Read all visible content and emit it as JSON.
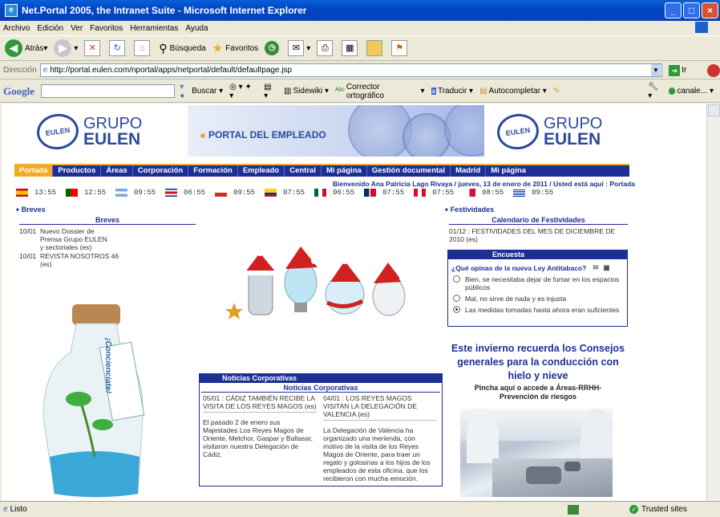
{
  "window": {
    "title": "Net.Portal 2005, the Intranet Suite - Microsoft Internet Explorer"
  },
  "menu": [
    "Archivo",
    "Edición",
    "Ver",
    "Favoritos",
    "Herramientas",
    "Ayuda"
  ],
  "toolbar": {
    "back": "Atrás",
    "search": "Búsqueda",
    "favorites": "Favoritos"
  },
  "address": {
    "label": "Dirección",
    "url": "http://portal.eulen.com/nportal/apps/netportal/default/defaultpage.jsp",
    "go": "Ir"
  },
  "google": {
    "logo": "Google",
    "buscar": "Buscar",
    "sidewiki": "Sidewiki",
    "corrector": "Corrector ortográfico",
    "traducir": "Traducir",
    "autocompletar": "Autocompletar",
    "profile": "canale..."
  },
  "logo": {
    "line1": "GRUPO",
    "line2": "EULEN"
  },
  "banner": {
    "title": "PORTAL DEL EMPLEADO"
  },
  "nav": [
    "Portada",
    "Productos",
    "Áreas",
    "Corporación",
    "Formación",
    "Empleado",
    "Central",
    "Mi página",
    "Gestión documental",
    "Madrid",
    "Mi página"
  ],
  "welcome": "Bienvenido Ana Patricia Lago Rivaya / jueves, 13 de enero de 2011 / Usted está aquí : Portada",
  "clocks": [
    {
      "time": "13:55",
      "flag": "es"
    },
    {
      "time": "12:55",
      "flag": "pt"
    },
    {
      "time": "09:55",
      "flag": "ar"
    },
    {
      "time": "06:55",
      "flag": "cr"
    },
    {
      "time": "09:55",
      "flag": "cl"
    },
    {
      "time": "07:55",
      "flag": "co"
    },
    {
      "time": "06:55",
      "flag": "mx"
    },
    {
      "time": "07:55",
      "flag": "do"
    },
    {
      "time": "07:55",
      "flag": "pe"
    },
    {
      "time": "08:55",
      "flag": "pa"
    },
    {
      "time": "09:55",
      "flag": "uy"
    }
  ],
  "breves": {
    "section": "Breves",
    "title": "Breves",
    "items": [
      {
        "date": "10/01",
        "text": "Nuevo Dossier de Prensa Grupo EULEN y sectoriales (es)"
      },
      {
        "date": "10/01",
        "text": "REVISTA NOSOTROS 46 (es)"
      }
    ]
  },
  "festividades": {
    "section": "Festividades",
    "title": "Calendario de Festividades",
    "item": "01/12 : FESTIVIDADES DEL MES DE DICIEMBRE DE 2010 (es)"
  },
  "encuesta": {
    "header": "Encuesta",
    "question": "¿Qué opinas de la nueva Ley Antitabaco?",
    "options": [
      {
        "text": "Bien, se necesitaba dejar de fumar en los espacios públicos",
        "selected": false
      },
      {
        "text": "Mal, no sirve de nada y es injusta",
        "selected": false
      },
      {
        "text": "Las medidas tomadas hasta ahora eran suficientes",
        "selected": true
      }
    ]
  },
  "noticias": {
    "header": "Noticias Corporativas",
    "title": "Noticias Corporativas",
    "left": {
      "headline": "05/01 : CÁDIZ TAMBIÉN RECIBE LA VISITA DE LOS REYES MAGOS (es)",
      "body": "El pasado 2 de enero sus Majestades Los Reyes Magos de Oriente, Melchor, Gaspar y Baltasar, visitaron nuestra Delegación de Cádiz."
    },
    "right": {
      "headline": "04/01 : LOS REYES MAGOS VISITAN LA DELEGACIÓN DE VALENCIA (es)",
      "body": "La Delegación de Valencia ha organizado una merienda, con motivo de la visita de los Reyes Magos de Oriente, para traer un regalo y golosinas a los hijos de los empleados de esta oficina, que los recibieron con mucha emoción."
    }
  },
  "consejos": {
    "text": "Este invierno recuerda los Consejos generales para la conducción con hielo y nieve",
    "link": "Pincha aquí o accede a Áreas-RRHH-Prevención de riesgos"
  },
  "bottle": {
    "text": "¡Concienciate!"
  },
  "status": {
    "left": "Listo",
    "right": "Trusted sites"
  },
  "colors": {
    "nav": "#1c2f95",
    "accent": "#f4a920",
    "titlebar": "#0047c6"
  }
}
